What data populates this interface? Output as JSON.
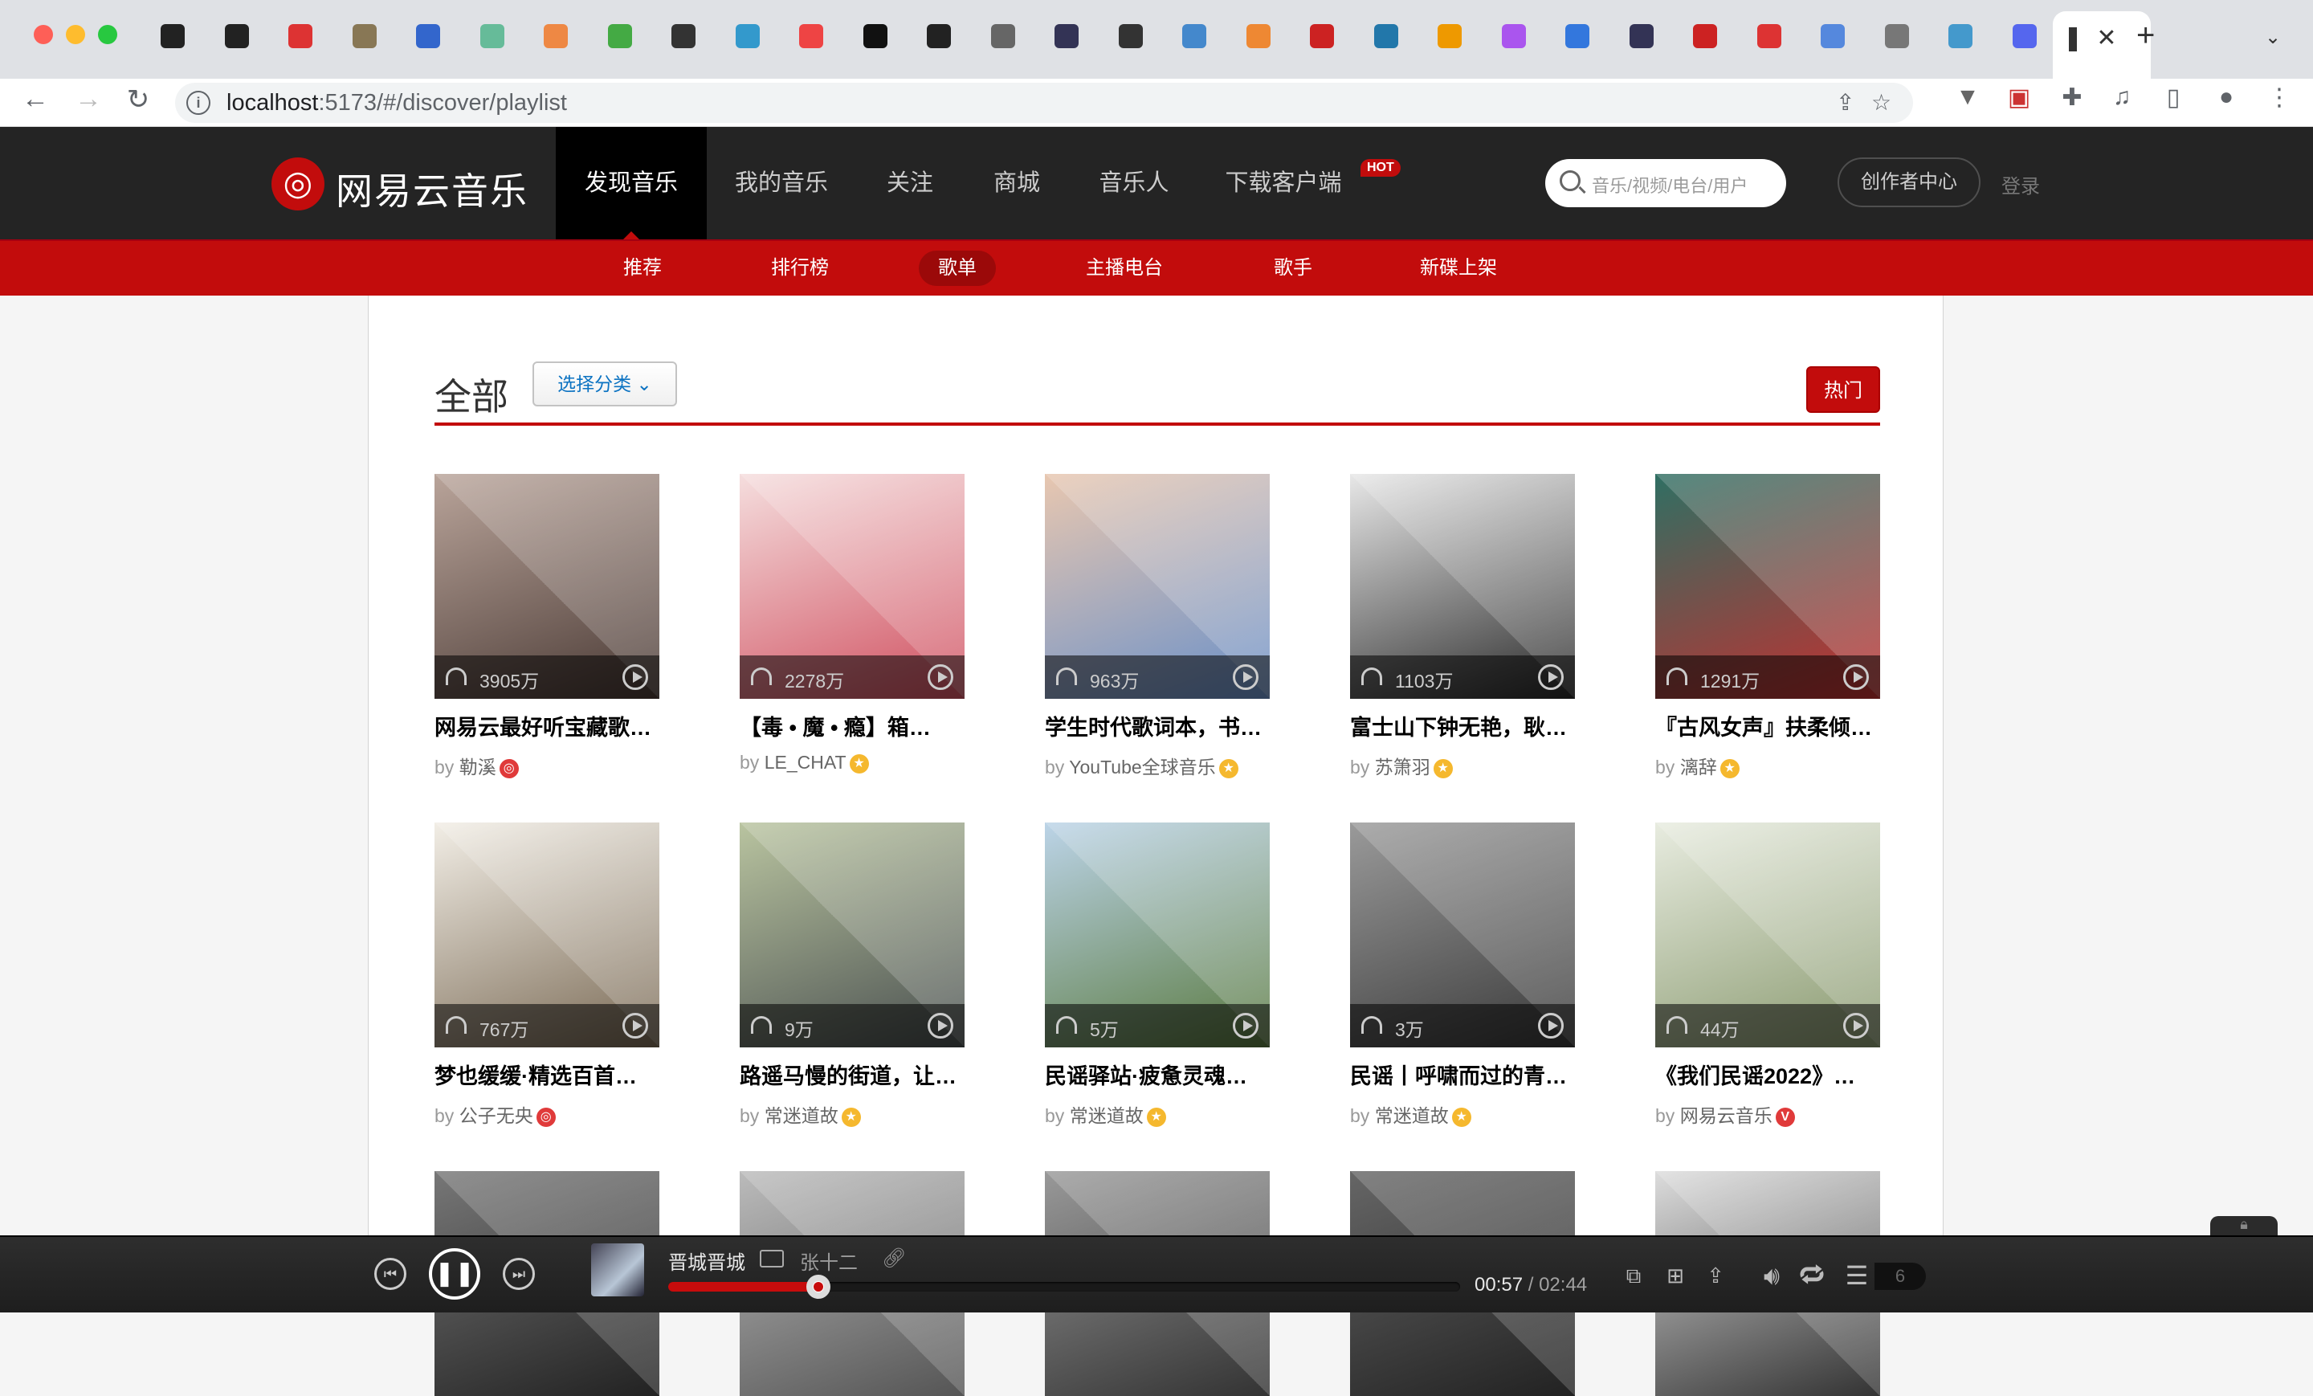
{
  "browser": {
    "url_host": "localhost",
    "url_rest": ":5173/#/discover/playlist",
    "new_tab": "+",
    "close_tab": "✕"
  },
  "header": {
    "logo_text": "网易云音乐",
    "nav": [
      "发现音乐",
      "我的音乐",
      "关注",
      "商城",
      "音乐人",
      "下载客户端"
    ],
    "hot_badge": "HOT",
    "search_placeholder": "音乐/视频/电台/用户",
    "creator": "创作者中心",
    "login": "登录"
  },
  "subnav": [
    "推荐",
    "排行榜",
    "歌单",
    "主播电台",
    "歌手",
    "新碟上架"
  ],
  "section": {
    "title": "全部",
    "category_btn": "选择分类",
    "hot_btn": "热门"
  },
  "playlists": [
    {
      "count": "3905万",
      "name": "网易云最好听宝藏歌…",
      "by": "by",
      "author": "勒溪",
      "badge": "red",
      "colors": [
        "#b9a49a",
        "#4a3a35"
      ]
    },
    {
      "count": "2278万",
      "name": "【毒 • 魔 • 瘾】箱…",
      "by": "by",
      "author": "LE_CHAT",
      "badge": "gold",
      "colors": [
        "#f5dede",
        "#d05060"
      ]
    },
    {
      "count": "963万",
      "name": "学生时代歌词本，书…",
      "by": "by",
      "author": "YouTube全球音乐",
      "badge": "gold",
      "colors": [
        "#e8c7b0",
        "#6a90c8"
      ]
    },
    {
      "count": "1103万",
      "name": "富士山下钟无艳，耿…",
      "by": "by",
      "author": "苏箫羽",
      "badge": "gold",
      "colors": [
        "#e8e8e8",
        "#2a2a2a"
      ]
    },
    {
      "count": "1291万",
      "name": "『古风女声』扶柔倾…",
      "by": "by",
      "author": "漓辞",
      "badge": "gold",
      "colors": [
        "#2f6f63",
        "#c23030"
      ]
    },
    {
      "count": "767万",
      "name": "梦也缓缓·精选百首…",
      "by": "by",
      "author": "公子无央",
      "badge": "red",
      "colors": [
        "#f2eee6",
        "#7a6a55"
      ]
    },
    {
      "count": "9万",
      "name": "路遥马慢的街道，让…",
      "by": "by",
      "author": "常迷道故",
      "badge": "gold",
      "colors": [
        "#b9c4a0",
        "#4a5050"
      ]
    },
    {
      "count": "5万",
      "name": "民谣驿站·疲惫灵魂…",
      "by": "by",
      "author": "常迷道故",
      "badge": "gold",
      "colors": [
        "#bcd4e8",
        "#5a7a40"
      ]
    },
    {
      "count": "3万",
      "name": "民谣丨呼啸而过的青…",
      "by": "by",
      "author": "常迷道故",
      "badge": "gold",
      "colors": [
        "#9a9a9a",
        "#3a3a3a"
      ]
    },
    {
      "count": "44万",
      "name": "《我们民谣2022》…",
      "by": "by",
      "author": "网易云音乐",
      "badge": "v",
      "colors": [
        "#e8ece0",
        "#8a9a70"
      ]
    },
    {
      "colors": [
        "#777",
        "#222"
      ]
    },
    {
      "colors": [
        "#bbb",
        "#555"
      ]
    },
    {
      "colors": [
        "#999",
        "#333"
      ]
    },
    {
      "colors": [
        "#666",
        "#222"
      ]
    },
    {
      "colors": [
        "#ddd",
        "#333"
      ]
    }
  ],
  "player": {
    "song": "晋城晋城",
    "singer": "张十二",
    "current_time": "00:57",
    "separator": "/",
    "duration": "02:44",
    "progress": 0.19,
    "queue_count": "6"
  }
}
